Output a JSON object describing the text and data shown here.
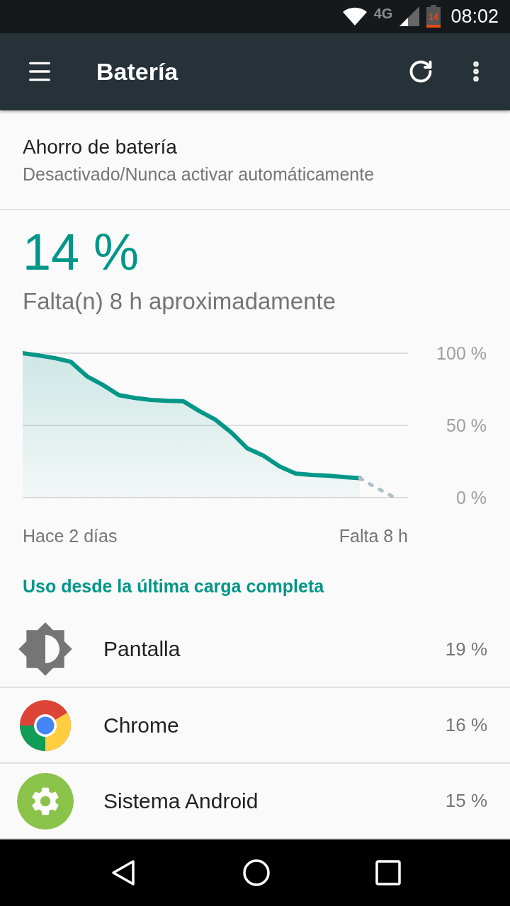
{
  "status_bar": {
    "network": "4G",
    "battery_text": "14",
    "time": "08:02"
  },
  "app_bar": {
    "title": "Batería"
  },
  "battery_saver": {
    "title": "Ahorro de batería",
    "subtitle": "Desactivado/Nunca activar automáticamente"
  },
  "battery": {
    "percent": "14 %",
    "remaining": "Falta(n) 8 h aproximadamente",
    "chart_data": {
      "type": "area",
      "ylim": [
        0,
        100
      ],
      "yticks": [
        {
          "value": 0,
          "label": "0 %"
        },
        {
          "value": 50,
          "label": "50 %"
        },
        {
          "value": 100,
          "label": "100 %"
        }
      ],
      "series": [
        {
          "color": "#009688",
          "values": [
            100,
            98.5,
            96.6,
            94,
            84,
            78,
            71,
            69,
            67.6,
            67,
            66.7,
            60,
            54,
            45,
            34,
            29,
            21.5,
            16.7,
            15.7,
            15.2,
            14.2,
            13.5,
            null,
            null
          ]
        },
        {
          "type": "line",
          "color": "#b0bec5",
          "line_style": "dotted",
          "values": [
            null,
            null,
            null,
            null,
            null,
            null,
            null,
            null,
            null,
            null,
            null,
            null,
            null,
            null,
            null,
            null,
            null,
            null,
            null,
            null,
            null,
            13.5,
            7,
            1
          ]
        }
      ]
    },
    "x_start": "Hace 2 días",
    "x_end": "Falta 8 h"
  },
  "usage_header": "Uso desde la última carga completa",
  "apps": [
    {
      "kind": "brightness",
      "name": "Pantalla",
      "usage": "19 %"
    },
    {
      "kind": "browser",
      "name": "Chrome",
      "usage": "16 %"
    },
    {
      "kind": "system",
      "name": "Sistema Android",
      "usage": "15 %"
    }
  ]
}
